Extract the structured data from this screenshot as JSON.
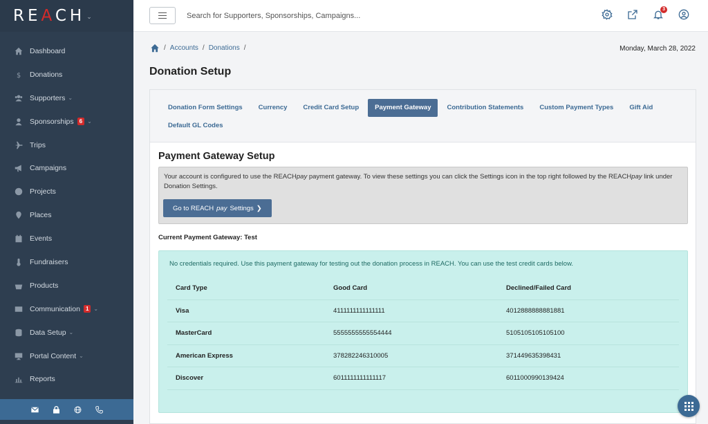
{
  "app": {
    "logo_left": "RE",
    "logo_a": "A",
    "logo_right": "CH",
    "logo_caret": "⌄"
  },
  "colors": {
    "sidebar_bg": "#2e3e50",
    "accent": "#3c6a94",
    "active_tab": "#4b6d94",
    "badge_red": "#d22b2b",
    "test_box": "#c9f0ec"
  },
  "sidebar": {
    "items": [
      {
        "label": "Dashboard",
        "icon": "home-icon"
      },
      {
        "label": "Donations",
        "icon": "dollar-icon"
      },
      {
        "label": "Supporters",
        "icon": "users-icon",
        "chevron": "⌄"
      },
      {
        "label": "Sponsorships",
        "icon": "user-icon",
        "badge": "6",
        "chevron": "⌄"
      },
      {
        "label": "Trips",
        "icon": "plane-icon"
      },
      {
        "label": "Campaigns",
        "icon": "megaphone-icon"
      },
      {
        "label": "Projects",
        "icon": "globe-icon"
      },
      {
        "label": "Places",
        "icon": "map-pin-icon"
      },
      {
        "label": "Events",
        "icon": "calendar-icon"
      },
      {
        "label": "Fundraisers",
        "icon": "thermometer-icon"
      },
      {
        "label": "Products",
        "icon": "basket-icon"
      },
      {
        "label": "Communication",
        "icon": "envelope-icon",
        "badge": "1",
        "chevron": "⌄"
      },
      {
        "label": "Data Setup",
        "icon": "database-icon",
        "chevron": "⌄"
      },
      {
        "label": "Portal Content",
        "icon": "monitor-icon",
        "chevron": "⌄"
      },
      {
        "label": "Reports",
        "icon": "bar-chart-icon"
      }
    ],
    "footer_icons": [
      "mail-icon",
      "lock-icon",
      "globe-icon",
      "phone-icon"
    ]
  },
  "header": {
    "search_placeholder": "Search for Supporters, Sponsorships, Campaigns...",
    "notification_count": "3",
    "icons": [
      "settings-icon",
      "external-link-icon",
      "bell-icon",
      "user-circle-icon"
    ]
  },
  "breadcrumb": {
    "sep": "/",
    "items": [
      "Accounts",
      "Donations"
    ],
    "trailing": "/"
  },
  "date": "Monday, March 28, 2022",
  "page_title": "Donation Setup",
  "tabs": [
    {
      "label": "Donation Form Settings"
    },
    {
      "label": "Currency"
    },
    {
      "label": "Credit Card Setup"
    },
    {
      "label": "Payment Gateway",
      "active": true
    },
    {
      "label": "Contribution Statements"
    },
    {
      "label": "Custom Payment Types"
    },
    {
      "label": "Gift Aid"
    },
    {
      "label": "Default GL Codes"
    }
  ],
  "gateway": {
    "title": "Payment Gateway Setup",
    "info_part1": "Your account is configured to use the REACH",
    "info_em": "pay",
    "info_part2": " payment gateway. To view these settings you can click the Settings icon in the top right followed by the REACH",
    "info_em2": "pay",
    "info_part3": " link under Donation Settings.",
    "button_part1": "Go to REACH",
    "button_em": "pay",
    "button_part2": " Settings",
    "button_chevron": "❯",
    "current": "Current Payment Gateway: Test",
    "test_note": "No credentials required. Use this payment gateway for testing out the donation process in REACH. You can use the test credit cards below."
  },
  "cards_table": {
    "headers": [
      "Card Type",
      "Good Card",
      "Declined/Failed Card"
    ],
    "rows": [
      [
        "Visa",
        "4111111111111111",
        "4012888888881881"
      ],
      [
        "MasterCard",
        "5555555555554444",
        "5105105105105100"
      ],
      [
        "American Express",
        "378282246310005",
        "371449635398431"
      ],
      [
        "Discover",
        "6011111111111117",
        "6011000990139424"
      ]
    ]
  }
}
